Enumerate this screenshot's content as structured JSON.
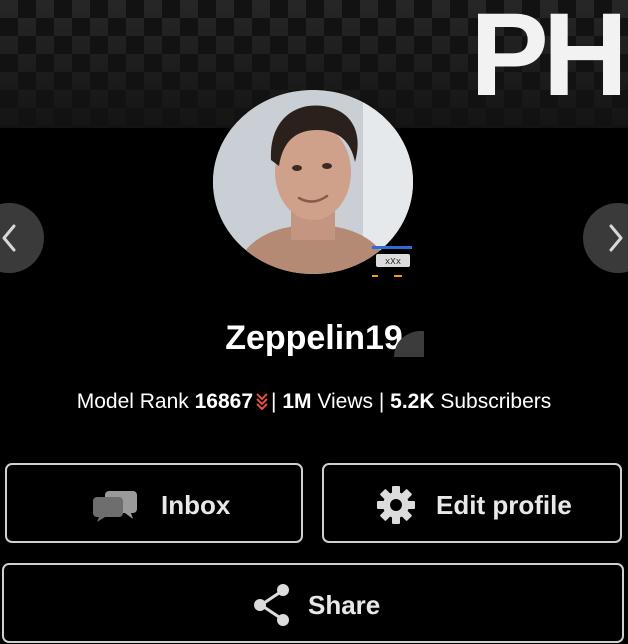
{
  "banner": {
    "logo_text": "PH"
  },
  "profile": {
    "username": "Zeppelin19",
    "avatar_badge_icon": "model-badge-icon",
    "verified_icon": "verified-badge-icon"
  },
  "stats": {
    "rank_label": "Model Rank",
    "rank_value": "16867",
    "rank_trend_icon": "rank-down-chevrons-icon",
    "rank_trend_color": "#e0533a",
    "separator": "|",
    "views_value": "1M",
    "views_label": "Views",
    "subscribers_value": "5.2K",
    "subscribers_label": "Subscribers"
  },
  "nav": {
    "prev_icon": "chevron-left-icon",
    "next_icon": "chevron-right-icon"
  },
  "actions": {
    "inbox_label": "Inbox",
    "inbox_icon": "chat-bubbles-icon",
    "edit_label": "Edit profile",
    "edit_icon": "gear-icon",
    "share_label": "Share",
    "share_icon": "share-icon"
  },
  "colors": {
    "background": "#000000",
    "button_border": "#cfcfcf",
    "nav_circle": "#3a3a3a",
    "accent": "#e0533a"
  }
}
